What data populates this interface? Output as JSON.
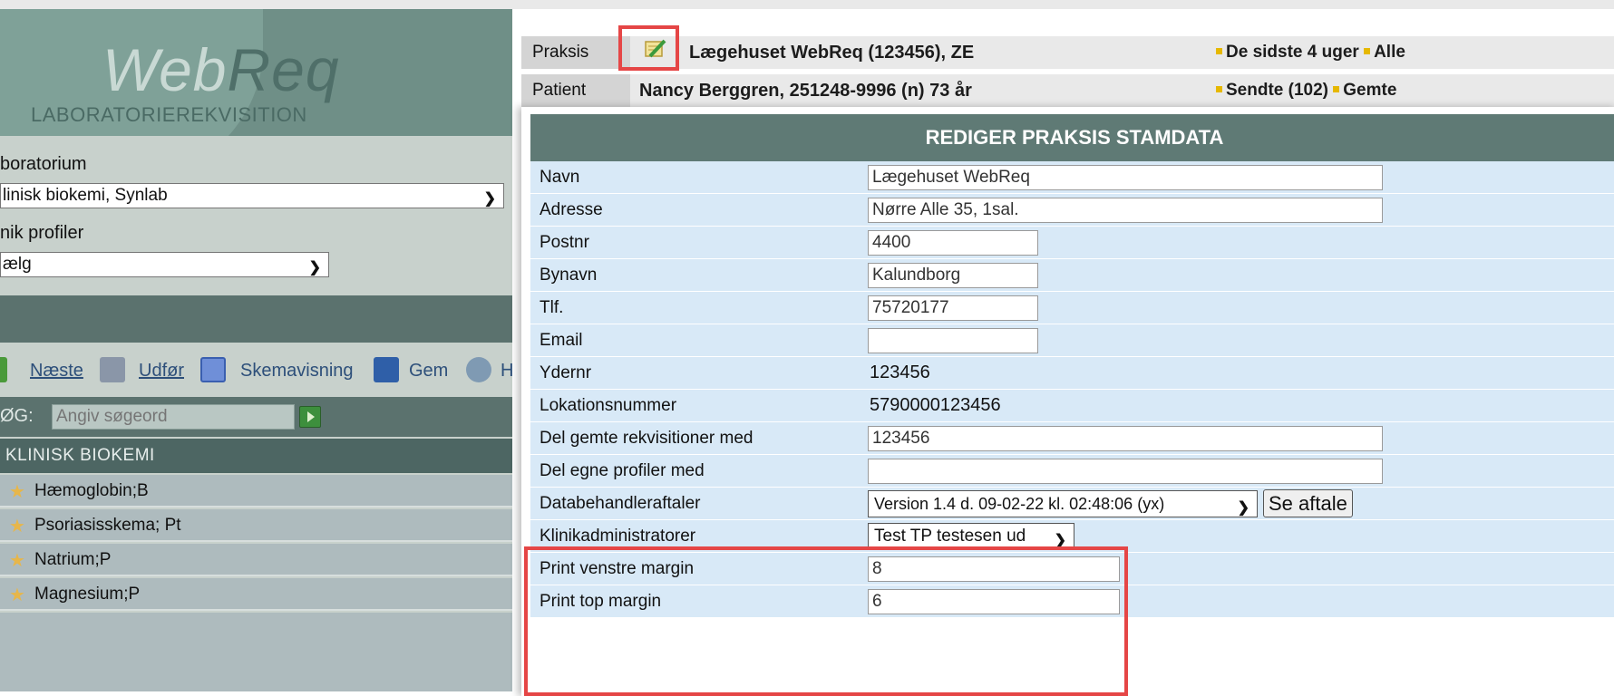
{
  "app": {
    "logo_word_1": "Web",
    "logo_word_2": "Req",
    "logo_subtitle": "LABORATORIEREKVISITION"
  },
  "sidebar": {
    "laboratorium_label": "boratorium",
    "laboratorium_value": "linisk biokemi, Synlab",
    "profiler_label": "nik profiler",
    "profiler_value": "ælg",
    "toolbar": {
      "next_label": "Næste",
      "execute_label": "Udfør",
      "schema_label": "Skemavisning",
      "save_label": "Gem",
      "extra_label": "H"
    },
    "search": {
      "label": "ØG:",
      "placeholder": "Angiv søgeord"
    },
    "category_label": "KLINISK BIOKEMI",
    "tests": [
      {
        "name": "Hæmoglobin;B"
      },
      {
        "name": "Psoriasisskema; Pt"
      },
      {
        "name": "Natrium;P"
      },
      {
        "name": "Magnesium;P"
      }
    ]
  },
  "info": {
    "praksis_label": "Praksis",
    "praksis_value": "Lægehuset WebReq (123456), ZE",
    "praksis_ext_1": "De sidste 4 uger",
    "praksis_ext_2": "Alle",
    "patient_label": "Patient",
    "patient_value": "Nancy Berggren, 251248-9996 (n)  73 år",
    "patient_ext_1": "Sendte (102)",
    "patient_ext_2": "Gemte"
  },
  "dialog": {
    "title": "REDIGER PRAKSIS STAMDATA",
    "fields": [
      {
        "label": "Navn",
        "value": "Lægehuset WebReq"
      },
      {
        "label": "Adresse",
        "value": "Nørre Alle 35, 1sal."
      },
      {
        "label": "Postnr",
        "value": "4400"
      },
      {
        "label": "Bynavn",
        "value": "Kalundborg"
      },
      {
        "label": "Tlf.",
        "value": "75720177"
      },
      {
        "label": "Email",
        "value": ""
      },
      {
        "label": "Ydernr",
        "value": "123456"
      },
      {
        "label": "Lokationsnummer",
        "value": "5790000123456"
      },
      {
        "label": "Del gemte rekvisitioner med",
        "value": "123456"
      },
      {
        "label": "Del egne profiler med",
        "value": ""
      },
      {
        "label": "Databehandleraftaler",
        "value": "Version 1.4 d. 09-02-22 kl. 02:48:06 (yx)",
        "button": "Se aftale"
      },
      {
        "label": "Klinikadministratorer",
        "value": "Test TP testesen ud"
      },
      {
        "label": "Print venstre margin",
        "value": "8"
      },
      {
        "label": "Print top margin",
        "value": "6"
      }
    ]
  },
  "colors": {
    "header_bg": "#5f7a75",
    "row_bg": "#d8e9f7",
    "highlight": "#e54646",
    "link": "#2d4f7a"
  }
}
